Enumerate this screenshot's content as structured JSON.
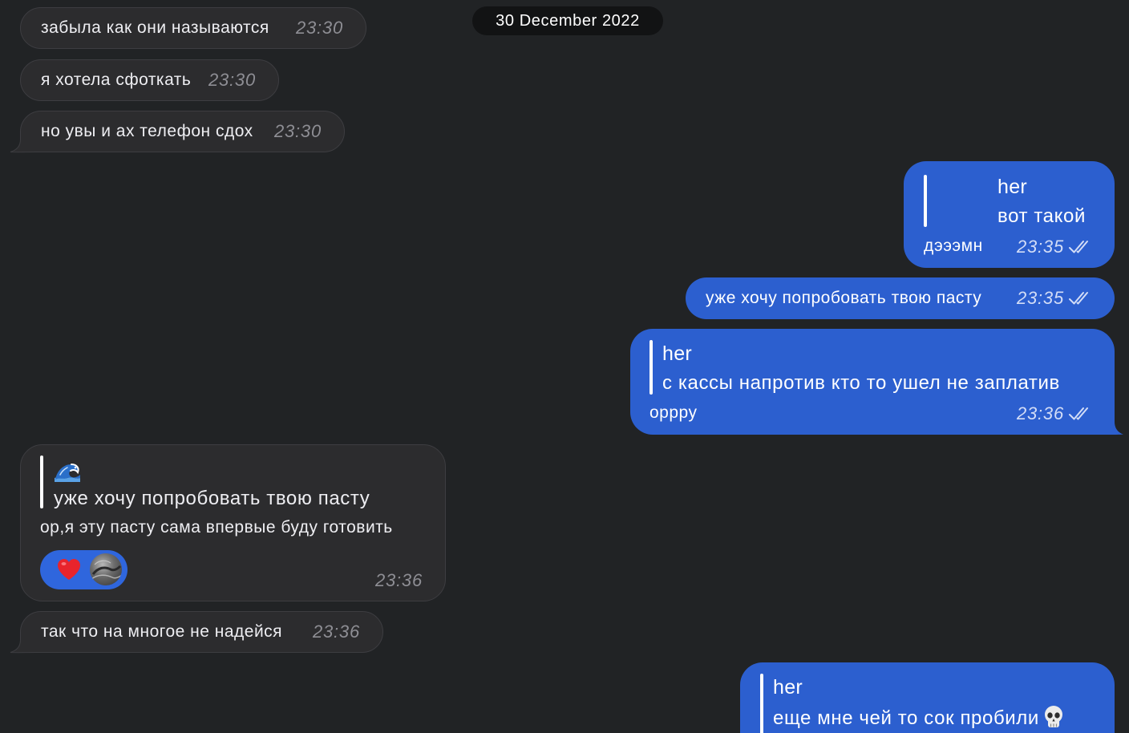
{
  "date_separator": "30 December 2022",
  "messages": [
    {
      "outgoing": false,
      "text": "забыла как они называются",
      "time": "23:30"
    },
    {
      "outgoing": false,
      "text": "я хотела сфоткать",
      "time": "23:30"
    },
    {
      "outgoing": false,
      "text": "но увы и ах телефон сдох",
      "time": "23:30"
    },
    {
      "outgoing": true,
      "reply": {
        "author": "her",
        "text": "вот такой"
      },
      "text": "дэээмн",
      "time": "23:35",
      "status_icon": "double-check-icon"
    },
    {
      "outgoing": true,
      "text": "уже хочу попробовать твою пасту",
      "time": "23:35",
      "status_icon": "double-check-icon"
    },
    {
      "outgoing": true,
      "reply": {
        "author": "her",
        "text": "с кассы напротив кто то ушел не заплатив"
      },
      "text": "оррру",
      "time": "23:36",
      "status_icon": "double-check-icon"
    },
    {
      "outgoing": false,
      "reply": {
        "author_icon": "water-wave-emoji-icon",
        "text": "уже хочу попробовать твою пасту"
      },
      "text": "ор,я эту пасту сама впервые буду готовить",
      "time": "23:36",
      "reactions": [
        {
          "icon": "red-heart-emoji-icon",
          "reactor_icon": "avatar-icon"
        }
      ]
    },
    {
      "outgoing": false,
      "text": "так что на многое не надейся",
      "time": "23:36"
    },
    {
      "outgoing": true,
      "reply": {
        "author": "her",
        "text": "еще мне чей то сок пробили",
        "trailing_icon": "skull-emoji-icon"
      }
    }
  ],
  "colors": {
    "background": "#212325",
    "incoming_bubble": "#2c2c2e",
    "incoming_border": "#3d3d41",
    "outgoing_bubble": "#2c5fcf",
    "reaction_pill": "#2f66dd",
    "date_pill": "#121314"
  }
}
